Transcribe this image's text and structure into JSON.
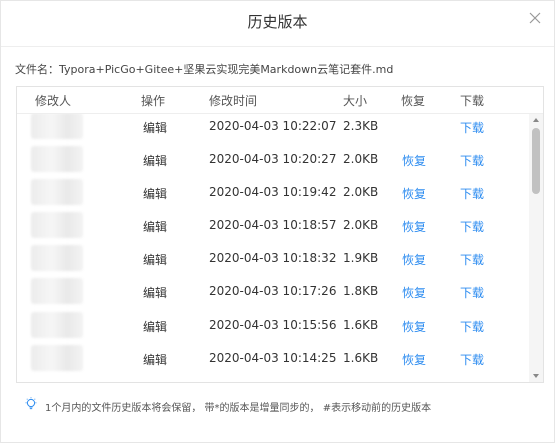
{
  "dialog": {
    "title": "历史版本",
    "filename_label": "文件名：Typora+PicGo+Gitee+坚果云实现完美Markdown云笔记套件.md"
  },
  "table": {
    "headers": {
      "editor": "修改人",
      "action": "操作",
      "time": "修改时间",
      "size": "大小",
      "restore": "恢复",
      "download": "下载"
    },
    "rows": [
      {
        "action": "编辑",
        "time": "2020-04-03 10:22:07",
        "size": "2.3KB",
        "restore": "",
        "download": "下载"
      },
      {
        "action": "编辑",
        "time": "2020-04-03 10:20:27",
        "size": "2.0KB",
        "restore": "恢复",
        "download": "下载"
      },
      {
        "action": "编辑",
        "time": "2020-04-03 10:19:42",
        "size": "2.0KB",
        "restore": "恢复",
        "download": "下载"
      },
      {
        "action": "编辑",
        "time": "2020-04-03 10:18:57",
        "size": "2.0KB",
        "restore": "恢复",
        "download": "下载"
      },
      {
        "action": "编辑",
        "time": "2020-04-03 10:18:32",
        "size": "1.9KB",
        "restore": "恢复",
        "download": "下载"
      },
      {
        "action": "编辑",
        "time": "2020-04-03 10:17:26",
        "size": "1.8KB",
        "restore": "恢复",
        "download": "下载"
      },
      {
        "action": "编辑",
        "time": "2020-04-03 10:15:56",
        "size": "1.6KB",
        "restore": "恢复",
        "download": "下载"
      },
      {
        "action": "编辑",
        "time": "2020-04-03 10:14:25",
        "size": "1.6KB",
        "restore": "恢复",
        "download": "下载"
      }
    ]
  },
  "footer": {
    "note": "1个月内的文件历史版本将会保留， 带*的版本是增量同步的， #表示移动前的历史版本"
  },
  "colors": {
    "link": "#2d8cf0",
    "bulb": "#2d8cf0"
  },
  "icons": {
    "close": "close-icon",
    "hint": "lightbulb-icon"
  }
}
